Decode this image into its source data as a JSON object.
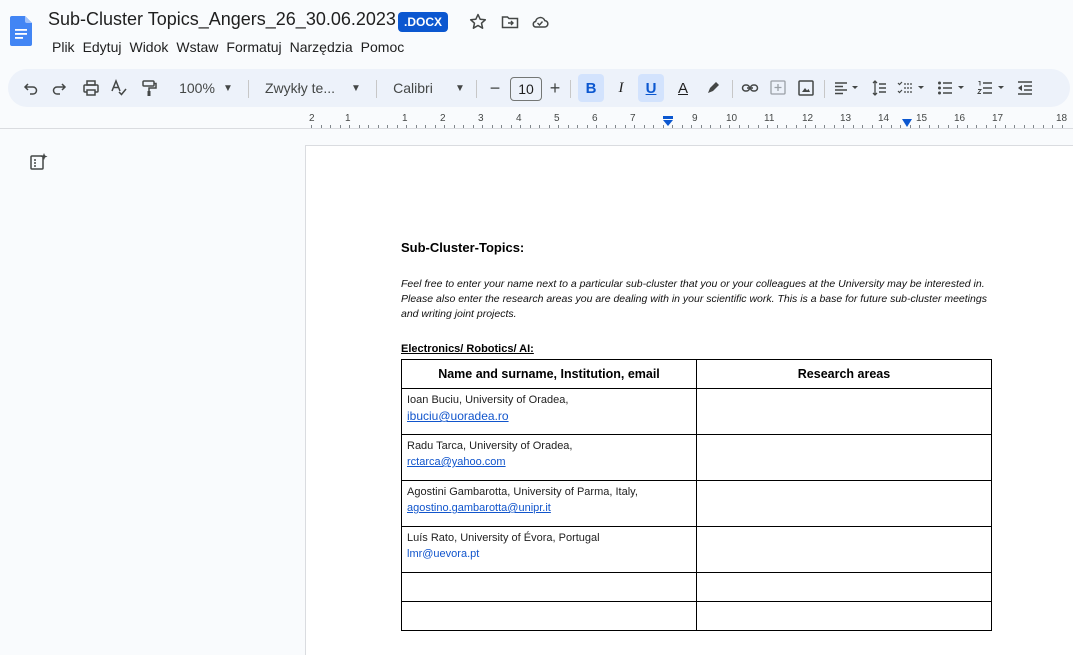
{
  "header": {
    "title": "Sub-Cluster Topics_Angers_26_30.06.2023",
    "badge": ".DOCX",
    "menu": [
      "Plik",
      "Edytuj",
      "Widok",
      "Wstaw",
      "Formatuj",
      "Narzędzia",
      "Pomoc"
    ]
  },
  "toolbar": {
    "zoom": "100%",
    "style": "Zwykły te...",
    "font": "Calibri",
    "font_size": "10",
    "bold": "B",
    "italic": "I",
    "underline": "U",
    "text_color": "A",
    "minus": "−",
    "plus": "+"
  },
  "ruler": {
    "numbers": [
      "2",
      "1",
      "1",
      "2",
      "3",
      "4",
      "5",
      "6",
      "7",
      "9",
      "10",
      "11",
      "12",
      "13",
      "14",
      "15",
      "16",
      "17",
      "18"
    ]
  },
  "document": {
    "heading": "Sub-Cluster-Topics:",
    "intro": "Feel free to enter your name next to a particular sub-cluster that you or your colleagues at the University may be interested in. Please also enter the research areas you are dealing with in your scientific work. This is a base for future sub-cluster meetings and writing joint projects.",
    "section": "Electronics/ Robotics/ AI:",
    "table": {
      "headers": [
        "Name and surname, Institution, email",
        "Research areas"
      ],
      "rows": [
        {
          "name": "Ioan Buciu, University of Oradea,",
          "email": "ibuciu@uoradea.ro"
        },
        {
          "name": "Radu Tarca, University of Oradea,",
          "email": "rctarca@yahoo.com"
        },
        {
          "name": "Agostini Gambarotta, University of Parma, Italy,",
          "email": "agostino.gambarotta@unipr.it"
        },
        {
          "name": "Luís Rato, University of Évora, Portugal",
          "email": "lmr@uevora.pt"
        }
      ]
    }
  },
  "colors": {
    "accent": "#0b57d0",
    "toolbar_bg": "#edf2fa",
    "link": "#1155cc"
  }
}
